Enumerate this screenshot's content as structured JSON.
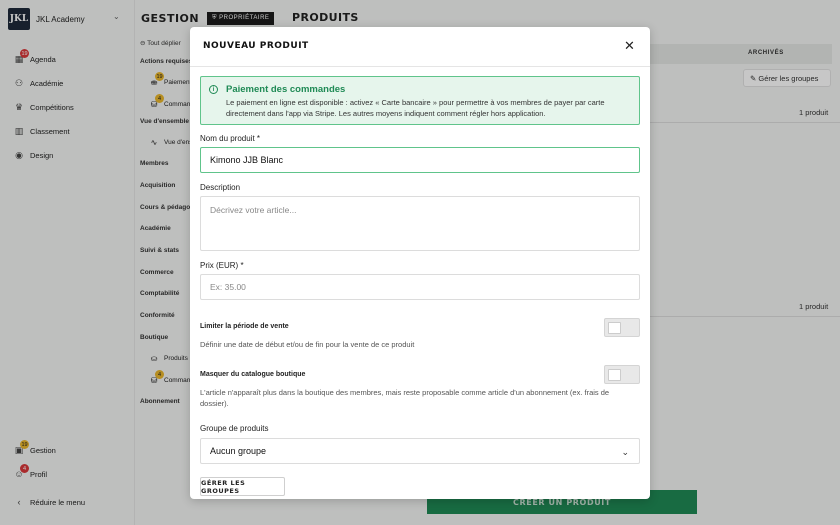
{
  "sidebar": {
    "logo_text": "JKL",
    "brand_name": "JKL Academy",
    "items": [
      {
        "label": "Agenda",
        "badge": "19"
      },
      {
        "label": "Académie",
        "badge": ""
      },
      {
        "label": "Compétitions",
        "badge": ""
      },
      {
        "label": "Classement",
        "badge": ""
      },
      {
        "label": "Design",
        "badge": ""
      }
    ],
    "bottom": [
      {
        "label": "Gestion",
        "badge": "19"
      },
      {
        "label": "Profil",
        "badge": "4"
      }
    ],
    "collapse_label": "Réduire le menu"
  },
  "subnav": {
    "title": "GESTION",
    "owner_badge": "PROPRIÉTAIRE",
    "collapse_all": "Tout déplier",
    "sections": [
      {
        "label": "Actions requises"
      },
      {
        "label": "Vue d'ensemble"
      },
      {
        "label": "Membres"
      },
      {
        "label": "Acquisition"
      },
      {
        "label": "Cours & pédagogie"
      },
      {
        "label": "Académie"
      },
      {
        "label": "Suivi & stats"
      },
      {
        "label": "Commerce"
      },
      {
        "label": "Comptabilité"
      },
      {
        "label": "Conformité"
      },
      {
        "label": "Boutique"
      },
      {
        "label": "Abonnement"
      }
    ],
    "items": [
      {
        "label": "Paiements",
        "badge": "19"
      },
      {
        "label": "Commandes",
        "badge": "4"
      },
      {
        "label": "Vue d'ensemble",
        "badge": ""
      },
      {
        "label": "Produits",
        "badge": ""
      },
      {
        "label": "Commandes",
        "badge": "4"
      }
    ]
  },
  "main": {
    "title": "PRODUITS",
    "archived_label": "ARCHIVÉS",
    "manage_groups": "Gérer les groupes",
    "count_1": "1 produit",
    "count_2": "1 produit",
    "create_button": "CRÉER UN PRODUIT"
  },
  "modal": {
    "title": "NOUVEAU PRODUIT",
    "alert": {
      "title": "Paiement des commandes",
      "body": "Le paiement en ligne est disponible : activez « Carte bancaire » pour permettre à vos membres de payer par carte directement dans l'app via Stripe. Les autres moyens indiquent comment régler hors application."
    },
    "name_label": "Nom du produit *",
    "name_value": "Kimono JJB Blanc",
    "description_label": "Description",
    "description_placeholder": "Décrivez votre article...",
    "price_label": "Prix (EUR) *",
    "price_placeholder": "Ex: 35.00",
    "limit_label": "Limiter la période de vente",
    "limit_hint": "Définir une date de début et/ou de fin pour la vente de ce produit",
    "hide_label": "Masquer du catalogue boutique",
    "hide_hint": "L'article n'apparaît plus dans la boutique des membres, mais reste proposable comme article d'un abonnement (ex. frais de dossier).",
    "group_label": "Groupe de produits",
    "group_value": "Aucun groupe",
    "manage_groups_button": "GÉRER LES GROUPES"
  }
}
